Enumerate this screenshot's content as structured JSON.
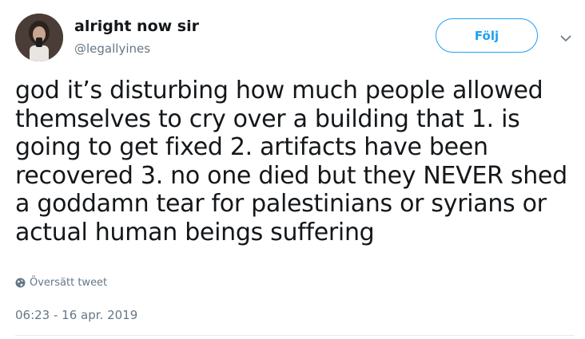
{
  "user": {
    "display_name": "alright now sir",
    "handle": "@legallyines",
    "avatar_icon": "user-avatar"
  },
  "actions": {
    "follow_label": "Följ",
    "menu_icon": "chevron-down-icon"
  },
  "tweet": {
    "text": "god it’s disturbing how much people allowed themselves to cry over a building that 1. is going to get fixed 2. artifacts have been recovered 3. no one died but they NEVER shed a goddamn tear for palestinians or syrians or actual human beings suffering",
    "translate_label": "Översätt tweet",
    "translate_icon": "globe-icon",
    "timestamp": "06:23 - 16 apr. 2019"
  },
  "colors": {
    "accent": "#1da1f2",
    "text": "#14171a",
    "muted": "#657786",
    "divider": "#e6ecf0"
  }
}
